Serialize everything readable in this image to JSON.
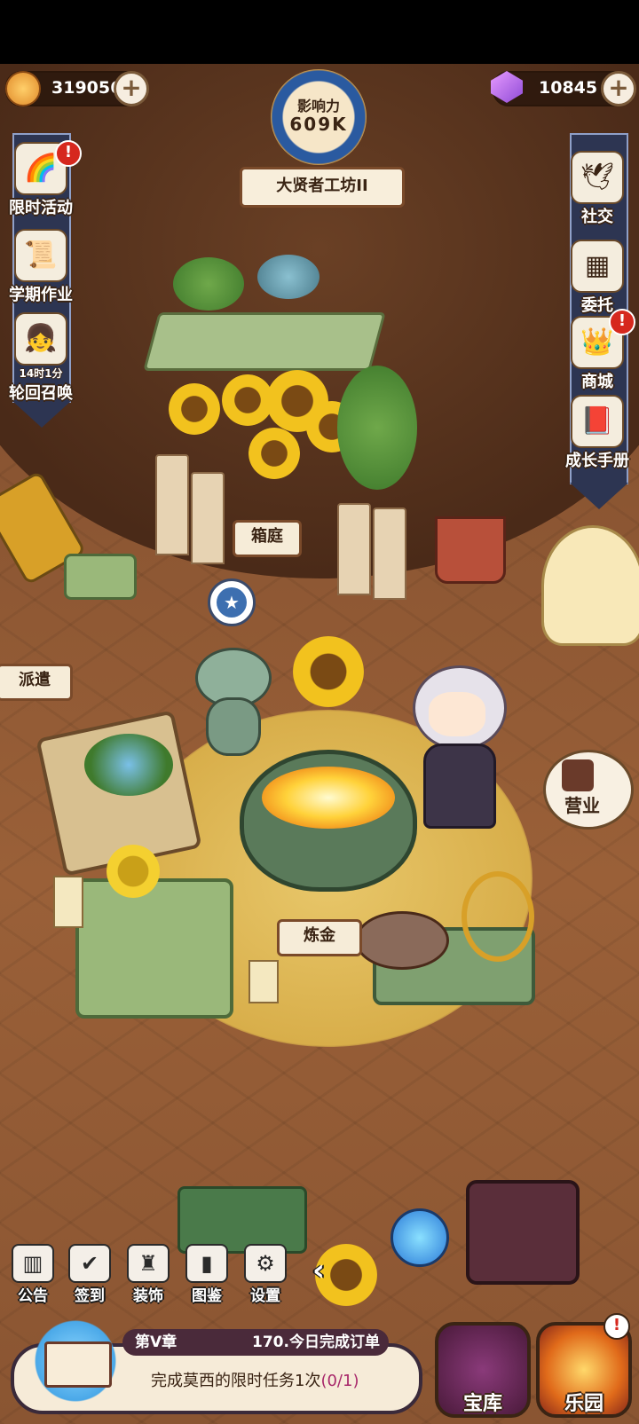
{
  "currency": {
    "coins": "319056",
    "gems": "10845"
  },
  "influence": {
    "label": "影响力",
    "value": "609K",
    "workshop": "大贤者工坊II"
  },
  "left_menu": [
    {
      "label": "限时活动",
      "icon": "event-icon"
    },
    {
      "label": "学期作业",
      "icon": "homework-icon"
    },
    {
      "label": "轮回召唤",
      "icon": "summon-icon",
      "timer": "14时1分"
    }
  ],
  "right_menu": [
    {
      "label": "社交",
      "icon": "social-icon"
    },
    {
      "label": "委托",
      "icon": "commission-icon"
    },
    {
      "label": "商城",
      "icon": "shop-icon"
    },
    {
      "label": "成长手册",
      "icon": "growth-book-icon"
    }
  ],
  "scene_signs": {
    "garden": "箱庭",
    "dispatch": "派遣",
    "alchemy": "炼金",
    "business": "营业"
  },
  "bottom_menu": [
    {
      "label": "公告",
      "icon": "announcement-icon"
    },
    {
      "label": "签到",
      "icon": "checkin-icon"
    },
    {
      "label": "装饰",
      "icon": "decoration-icon"
    },
    {
      "label": "图鉴",
      "icon": "codex-icon"
    },
    {
      "label": "设置",
      "icon": "settings-icon"
    }
  ],
  "quest": {
    "chapter": "第V章",
    "task_title": "170.今日完成订单",
    "description": "完成莫西的限时任务1次",
    "progress": "(0/1)"
  },
  "big_buttons": {
    "treasury": "宝库",
    "paradise": "乐园"
  },
  "colors": {
    "notify_red": "#d6281e",
    "banner_navy": "#2d3552"
  }
}
